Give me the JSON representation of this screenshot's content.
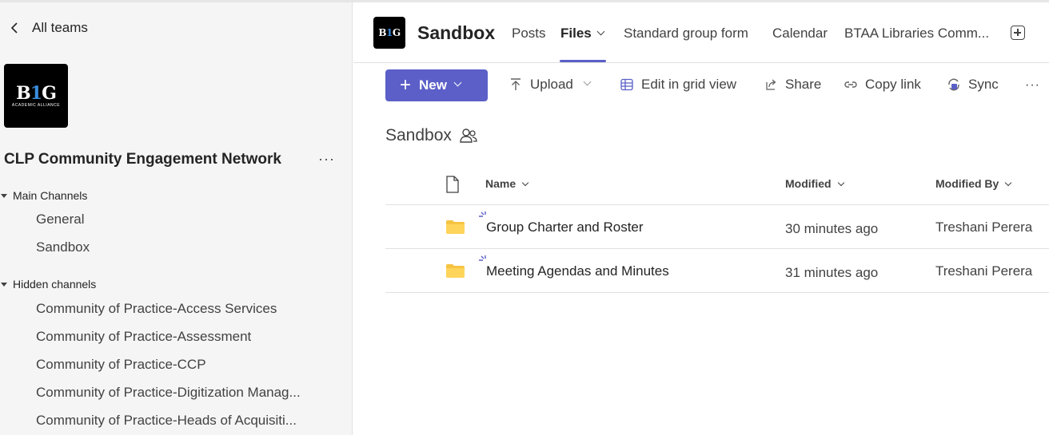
{
  "sidebar": {
    "back_label": "All teams",
    "logo_text": "B1G",
    "logo_subtext": "ACADEMIC ALLIANCE",
    "team_name": "CLP Community Engagement Network",
    "more_label": "···",
    "sections": [
      {
        "label": "Main Channels",
        "channels": [
          "General",
          "Sandbox"
        ]
      },
      {
        "label": "Hidden channels",
        "channels": [
          "Community of Practice-Access Services",
          "Community of Practice-Assessment",
          "Community of Practice-CCP",
          "Community of Practice-Digitization Manag...",
          "Community of Practice-Heads of Acquisiti..."
        ]
      }
    ]
  },
  "header": {
    "title": "Sandbox",
    "logo_text": "B1G",
    "tabs": [
      {
        "label": "Posts",
        "active": false
      },
      {
        "label": "Files",
        "active": true
      },
      {
        "label": "Standard group form",
        "active": false
      },
      {
        "label": "Calendar",
        "active": false
      },
      {
        "label": "BTAA Libraries Comm...",
        "active": false
      }
    ]
  },
  "toolbar": {
    "new_label": "New",
    "upload_label": "Upload",
    "grid_label": "Edit in grid view",
    "share_label": "Share",
    "copy_link_label": "Copy link",
    "sync_label": "Sync",
    "more_label": "···"
  },
  "breadcrumb": {
    "folder": "Sandbox"
  },
  "table": {
    "columns": {
      "name": "Name",
      "modified": "Modified",
      "modified_by": "Modified By"
    },
    "rows": [
      {
        "name": "Group Charter and Roster",
        "modified": "30 minutes ago",
        "modified_by": "Treshani Perera"
      },
      {
        "name": "Meeting Agendas and Minutes",
        "modified": "31 minutes ago",
        "modified_by": "Treshani Perera"
      }
    ]
  },
  "colors": {
    "accent": "#5b5fc7",
    "folder": "#f6c443",
    "sidebar_bg": "#f5f5f5"
  }
}
